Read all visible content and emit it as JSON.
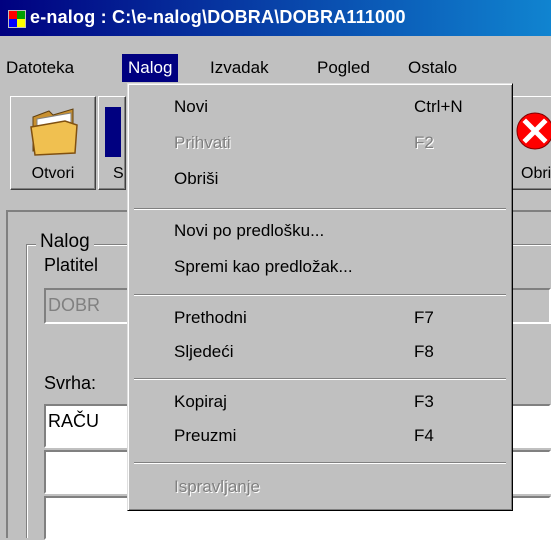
{
  "window": {
    "title": "e-nalog : C:\\e-nalog\\DOBRA\\DOBRA111000"
  },
  "menubar": {
    "items": [
      {
        "label": "Datoteka"
      },
      {
        "label": "Nalog"
      },
      {
        "label": "Izvadak"
      },
      {
        "label": "Pogled"
      },
      {
        "label": "Ostalo"
      }
    ]
  },
  "toolbar": {
    "open_label": "Otvori",
    "second_label": "S",
    "delete_label": "Obri"
  },
  "form": {
    "group_title": "Nalog",
    "payer_label": "Platitel",
    "payer_value": "DOBR",
    "purpose_label": "Svrha:",
    "purpose_value": "RAČU"
  },
  "dropdown": {
    "items": [
      {
        "label": "Novi",
        "shortcut": "Ctrl+N",
        "enabled": true
      },
      {
        "label": "Prihvati",
        "shortcut": "F2",
        "enabled": false
      },
      {
        "label": "Obriši",
        "shortcut": "",
        "enabled": true
      },
      {
        "label": "Novi po predlošku...",
        "shortcut": "",
        "enabled": true
      },
      {
        "label": "Spremi kao predložak...",
        "shortcut": "",
        "enabled": true
      },
      {
        "label": "Prethodni",
        "shortcut": "F7",
        "enabled": true
      },
      {
        "label": "Sljedeći",
        "shortcut": "F8",
        "enabled": true
      },
      {
        "label": "Kopiraj",
        "shortcut": "F3",
        "enabled": true
      },
      {
        "label": "Preuzmi",
        "shortcut": "F4",
        "enabled": true
      },
      {
        "label": "Ispravljanje",
        "shortcut": "",
        "enabled": false
      }
    ]
  }
}
